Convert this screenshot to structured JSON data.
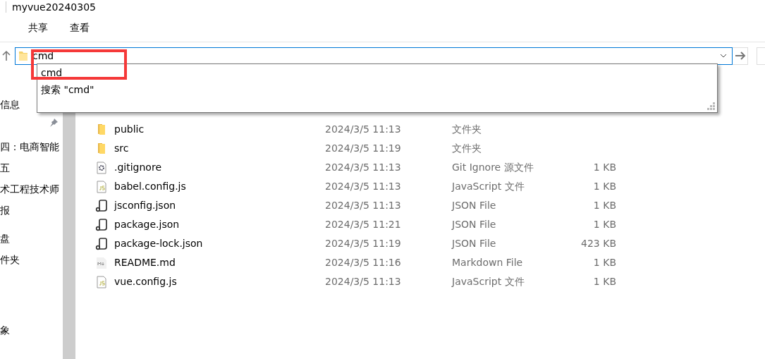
{
  "window": {
    "title": "myvue20240305"
  },
  "ribbon_tabs": [
    {
      "label": "共享",
      "selected": false
    },
    {
      "label": "查看",
      "selected": false
    }
  ],
  "address_bar": {
    "value": "cmd",
    "focused": true
  },
  "suggestions": [
    {
      "label": "cmd",
      "selected": false
    },
    {
      "label": "搜索 \"cmd\"",
      "selected": false
    }
  ],
  "sidebar": {
    "items": [
      {
        "label": "信息",
        "pinned": false
      },
      {
        "pinned": true
      },
      {
        "label": "四：电商智能",
        "pinned": false
      },
      {
        "label": "五",
        "pinned": false
      },
      {
        "label": "术工程技术师",
        "pinned": false
      },
      {
        "label": "报",
        "pinned": false
      },
      {
        "label": "盘",
        "pinned": false
      },
      {
        "label": "件夹",
        "pinned": false
      },
      {
        "label": "象",
        "pinned": false
      }
    ]
  },
  "files": [
    {
      "kind": "folder",
      "name": "public",
      "date": "2024/3/5 11:13",
      "type": "文件夹"
    },
    {
      "kind": "folder",
      "name": "src",
      "date": "2024/3/5 11:19",
      "type": "文件夹"
    },
    {
      "kind": "config",
      "name": ".gitignore",
      "date": "2024/3/5 11:13",
      "type": "Git Ignore 源文件",
      "size": "1 KB"
    },
    {
      "kind": "js",
      "name": "babel.config.js",
      "date": "2024/3/5 11:13",
      "type": "JavaScript 文件",
      "size": "1 KB"
    },
    {
      "kind": "json",
      "name": "jsconfig.json",
      "date": "2024/3/5 11:13",
      "type": "JSON File",
      "size": "1 KB"
    },
    {
      "kind": "json",
      "name": "package.json",
      "date": "2024/3/5 11:21",
      "type": "JSON File",
      "size": "1 KB"
    },
    {
      "kind": "json",
      "name": "package-lock.json",
      "date": "2024/3/5 11:19",
      "type": "JSON File",
      "size": "423 KB"
    },
    {
      "kind": "md",
      "name": "README.md",
      "date": "2024/3/5 11:16",
      "type": "Markdown File",
      "size": "1 KB"
    },
    {
      "kind": "js",
      "name": "vue.config.js",
      "date": "2024/3/5 11:13",
      "type": "JavaScript 文件",
      "size": "1 KB"
    }
  ]
}
